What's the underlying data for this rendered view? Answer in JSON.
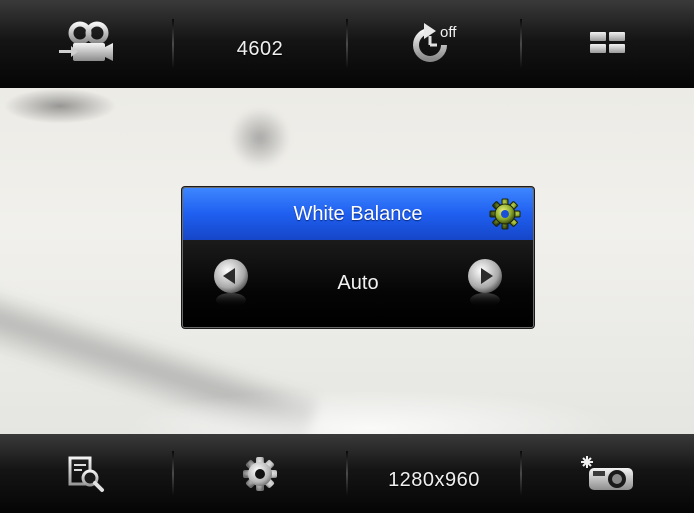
{
  "top_bar": {
    "mode_icon": "video-camera-switch-icon",
    "counter": "4602",
    "timer_icon": "self-timer-off-icon",
    "timer_label": "off",
    "grid_icon": "grid-icon"
  },
  "dialog": {
    "title": "White Balance",
    "title_icon": "gear-icon",
    "value": "Auto",
    "prev_icon": "arrow-left-icon",
    "next_icon": "arrow-right-icon"
  },
  "bottom_bar": {
    "review_icon": "review-search-icon",
    "settings_icon": "gear-icon",
    "resolution": "1280x960",
    "flash_icon": "flash-camera-icon"
  },
  "colors": {
    "header_blue": "#1f5ff0",
    "bar_dark": "#151515",
    "icon_light": "#d9d9d9"
  }
}
